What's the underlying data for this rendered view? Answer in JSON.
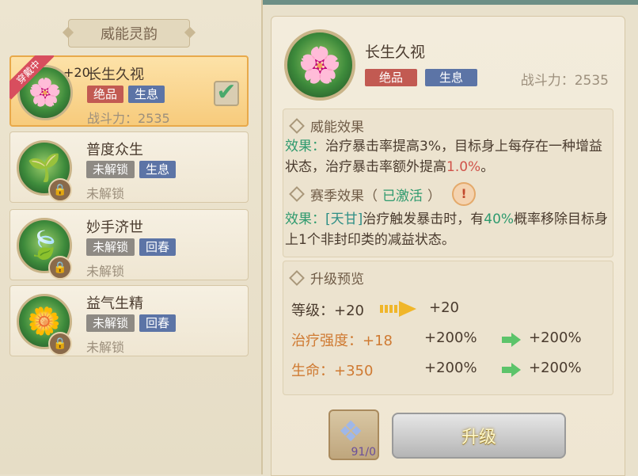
{
  "left_panel": {
    "title": "威能灵韵",
    "cards": [
      {
        "name": "长生久视",
        "level": "+20",
        "equipped_label": "穿戴中",
        "tags": [
          "绝品",
          "生息"
        ],
        "sub": "战斗力：2535",
        "selected": true,
        "icon": "pink-flower-icon"
      },
      {
        "name": "普度众生",
        "tags": [
          "未解锁",
          "生息"
        ],
        "sub": "未解锁",
        "selected": false,
        "icon": "pink-sprout-icon"
      },
      {
        "name": "妙手济世",
        "tags": [
          "未解锁",
          "回春"
        ],
        "sub": "未解锁",
        "selected": false,
        "icon": "green-leaf-icon"
      },
      {
        "name": "益气生精",
        "tags": [
          "未解锁",
          "回春"
        ],
        "sub": "未解锁",
        "selected": false,
        "icon": "golden-flower-icon"
      }
    ]
  },
  "detail": {
    "name": "长生久视",
    "tags": [
      "绝品",
      "生息"
    ],
    "power": "战斗力：2535",
    "effect_title": "威能效果",
    "effect_label": "效果：",
    "effect_text_1": "治疗暴击率提高3%，目标身上每存在一种增益状态，治疗暴击率额外提高",
    "effect_value": "1.0%",
    "effect_text_2": "。",
    "season_title": "赛季效果（",
    "season_status": "已激活",
    "season_close": "）",
    "season_label": "效果：",
    "season_tag": "[天甘]",
    "season_text_1": "治疗触发暴击时，有",
    "season_percent": "40%",
    "season_text_2": "概率移除目标身上1个非封印类的减益状态。",
    "upgrade_title": "升级预览",
    "level_label": "等级：+20",
    "level_after": "+20",
    "rows": [
      {
        "label": "治疗强度：+18",
        "before": "+200%",
        "after": "+200%"
      },
      {
        "label": "生命：+350",
        "before": "+200%",
        "after": "+200%"
      }
    ],
    "item_count": "91/0",
    "upgrade_button": "升级"
  },
  "colors": {
    "accent_red": "#c25a52",
    "accent_blue": "#5c74a6",
    "accent_green": "#2e9a6e"
  }
}
